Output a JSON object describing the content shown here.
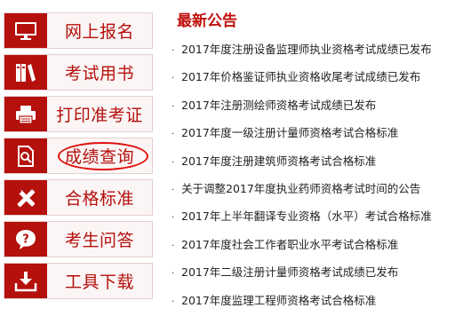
{
  "sidebar": {
    "items": [
      {
        "label": "网上报名",
        "icon": "monitor-icon"
      },
      {
        "label": "考试用书",
        "icon": "books-icon"
      },
      {
        "label": "打印准考证",
        "icon": "printer-icon"
      },
      {
        "label": "成绩查询",
        "icon": "document-search-icon"
      },
      {
        "label": "合格标准",
        "icon": "tools-icon"
      },
      {
        "label": "考生问答",
        "icon": "question-icon"
      },
      {
        "label": "工具下载",
        "icon": "download-icon"
      }
    ],
    "highlighted": "成绩查询"
  },
  "news": {
    "title": "最新公告",
    "items": [
      "2017年度注册设备监理师执业资格考试成绩已发布",
      "2017年价格鉴证师执业资格收尾考试成绩已发布",
      "2017年注册测绘师资格考试成绩已发布",
      "2017年度一级注册计量师资格考试合格标准",
      "2017年度注册建筑师资格考试合格标准",
      "关于调整2017年度执业药师资格考试时间的公告",
      "2017年上半年翻译专业资格（水平）考试合格标准",
      "2017年度社会工作者职业水平考试合格标准",
      "2017年二级注册计量师资格考试成绩已发布",
      "2017年度监理工程师资格考试合格标准"
    ]
  },
  "colors": {
    "accent": "#b4100c",
    "highlight_circle": "#e0100c"
  }
}
